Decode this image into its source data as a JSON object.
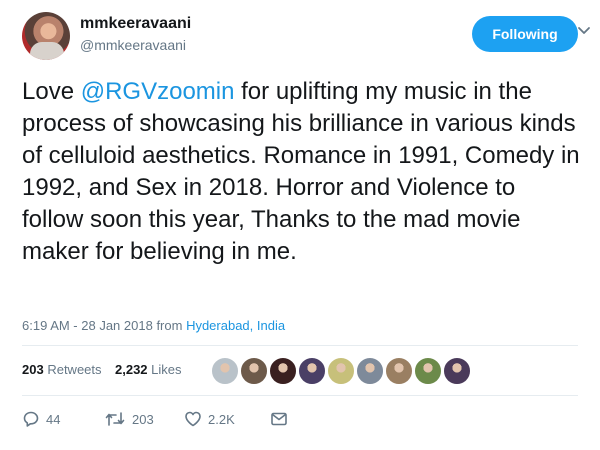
{
  "author": {
    "name": "mmkeeravaani",
    "handle": "@mmkeeravaani"
  },
  "follow_button": "Following",
  "tweet": {
    "p1": "Love ",
    "mention": "@RGVzoomin",
    "p2": " for uplifting my music in the process of showcasing his brilliance in various kinds of celluloid aesthetics. Romance in 1991, Comedy in 1992, and Sex in 2018. Horror and Violence to follow soon this year, Thanks to the mad movie maker for believing in me."
  },
  "meta": {
    "time": "6:19 AM - 28 Jan 2018",
    "from": "from",
    "location": "Hyderabad, India"
  },
  "stats": {
    "retweets_count": "203",
    "retweets_label": "Retweets",
    "likes_count": "2,232",
    "likes_label": "Likes"
  },
  "likers": [
    {
      "icon": "avatar-default",
      "color": "#b9c2c9"
    },
    {
      "icon": "avatar-face",
      "color": "#6d5a4a"
    },
    {
      "icon": "avatar-face",
      "color": "#3a2020"
    },
    {
      "icon": "avatar-face",
      "color": "#4a3f66"
    },
    {
      "icon": "avatar-face",
      "color": "#c7c07a"
    },
    {
      "icon": "avatar-face",
      "color": "#7e8a9a"
    },
    {
      "icon": "avatar-face",
      "color": "#9a7f62"
    },
    {
      "icon": "avatar-face",
      "color": "#6c8a4a"
    },
    {
      "icon": "avatar-face",
      "color": "#4a3a5a"
    }
  ],
  "actions": {
    "reply_count": "44",
    "retweet_count": "203",
    "like_count": "2.2K"
  },
  "colors": {
    "accent": "#1da1f2",
    "link": "#1b95e0",
    "muted": "#657786"
  }
}
